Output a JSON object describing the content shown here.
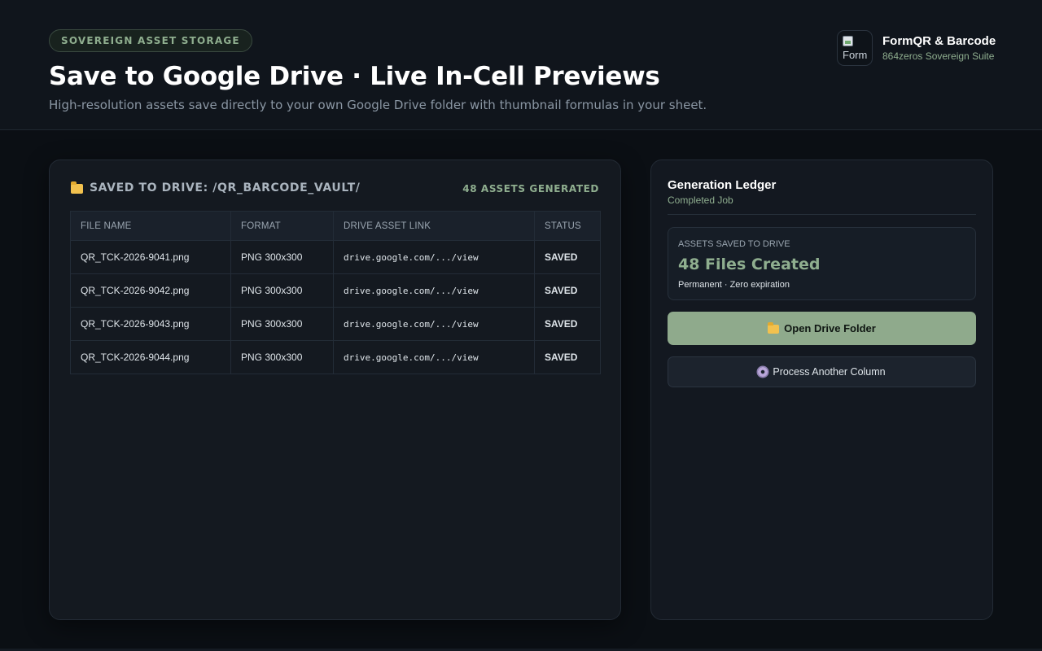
{
  "header": {
    "badge": "SOVEREIGN ASSET STORAGE",
    "title": "Save to Google Drive · Live In-Cell Previews",
    "subtitle": "High-resolution assets save directly to your own Google Drive folder with thumbnail formulas in your sheet."
  },
  "brand": {
    "logo_alt": "Form",
    "name": "FormQR & Barcode",
    "sub": "864zeros Sovereign Suite"
  },
  "main_panel": {
    "title": "SAVED TO DRIVE: /QR_BARCODE_VAULT/",
    "count": "48 ASSETS GENERATED",
    "columns": [
      "FILE NAME",
      "FORMAT",
      "DRIVE ASSET LINK",
      "STATUS"
    ],
    "rows": [
      {
        "file": "QR_TCK-2026-9041.png",
        "format": "PNG 300x300",
        "link": "drive.google.com/.../view",
        "status": "SAVED"
      },
      {
        "file": "QR_TCK-2026-9042.png",
        "format": "PNG 300x300",
        "link": "drive.google.com/.../view",
        "status": "SAVED"
      },
      {
        "file": "QR_TCK-2026-9043.png",
        "format": "PNG 300x300",
        "link": "drive.google.com/.../view",
        "status": "SAVED"
      },
      {
        "file": "QR_TCK-2026-9044.png",
        "format": "PNG 300x300",
        "link": "drive.google.com/.../view",
        "status": "SAVED"
      }
    ]
  },
  "ledger": {
    "title": "Generation Ledger",
    "sub": "Completed Job",
    "stat_label": "ASSETS SAVED TO DRIVE",
    "stat_value": "48 Files Created",
    "stat_note": "Permanent · Zero expiration",
    "primary_button": "Open Drive Folder",
    "secondary_button": "Process Another Column"
  },
  "colors": {
    "accent": "#8fae8f",
    "status_saved": "#2fbf73",
    "background": "#0b0f14"
  },
  "icons": [
    "folder-icon",
    "gear-icon",
    "broken-image-icon"
  ]
}
